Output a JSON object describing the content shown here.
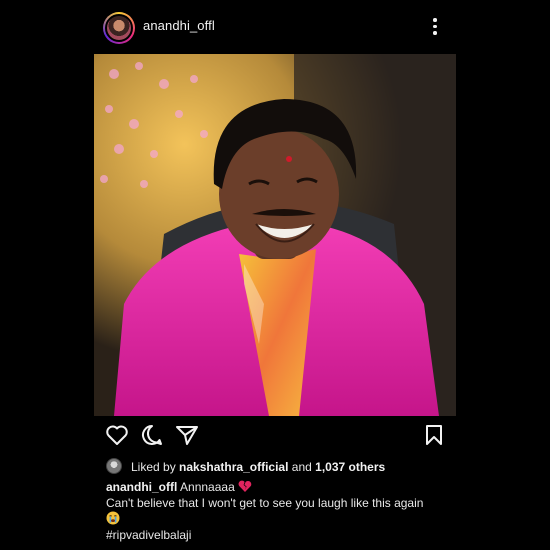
{
  "post": {
    "username": "anandhi_offl",
    "likes": {
      "prefix": "Liked by",
      "liker": "nakshathra_official",
      "connector": "and",
      "count_text": "1,037 others"
    },
    "caption": {
      "username": "anandhi_offl",
      "line1": "Annnaaaa",
      "line2": "Can't believe that I won't get to see you laugh like this again",
      "hashtag": "#ripvadivelbalaji"
    },
    "icons": {
      "more": "more-vertical-icon",
      "like": "heart-icon",
      "comment": "comment-icon",
      "share": "send-icon",
      "save": "bookmark-icon",
      "emoji1": "broken-heart-icon",
      "emoji2": "crying-face-icon"
    },
    "colors": {
      "background": "#000000",
      "text": "#f2f2f2",
      "jacket": "#e0219f",
      "broken_heart": "#e0245e"
    }
  }
}
